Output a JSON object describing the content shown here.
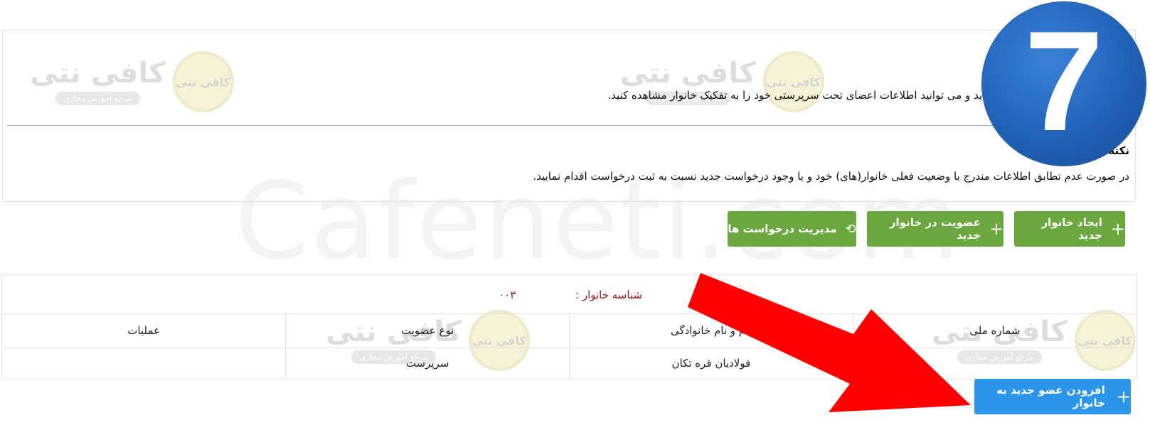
{
  "watermark": {
    "text": "Cafeneti.com",
    "logo_text": "کافی نتی",
    "logo_tagline": "مرجع آموزش مجازی",
    "logo_badge": "کافی نتی"
  },
  "info": {
    "line1": "سرپرست شناسایی شده اید و می توانید اطلاعات اعضای تحت سرپرستی خود را به تفکیک خانوار مشاهده کنید.",
    "note_label": "نکته",
    "line2": "در صورت عدم تطابق اطلاعات مندرج با وضعیت فعلی خانوار(های) خود و یا وجود درخواست جدید نسبت به ثبت درخواست اقدام نمایید."
  },
  "actions": {
    "create_family": "ایجاد خانوار جدید",
    "join_family": "عضویت در خانوار جدید",
    "manage_requests": "مدیریت درخواست ها"
  },
  "family": {
    "id_label": "شناسه خانوار :",
    "id_value": "۰۰۳",
    "columns": [
      "شماره ملی",
      "نام و نام خانوادگی",
      "نوع عضویت",
      "عملیات"
    ],
    "rows": [
      {
        "national_id": "",
        "full_name": "فولادیان قره تکان",
        "membership": "سرپرست",
        "operations": ""
      }
    ]
  },
  "add_member_button": "افزودن عضو جدید به خانوار",
  "step_badge": "7",
  "colors": {
    "green_button": "#6aa83f",
    "blue_button": "#2b95ea",
    "family_label": "#8b1a1a",
    "badge_blue": "#1e5fb5",
    "arrow_red": "#ff0000"
  },
  "icons": {
    "plus": "+",
    "history": "⟲"
  }
}
